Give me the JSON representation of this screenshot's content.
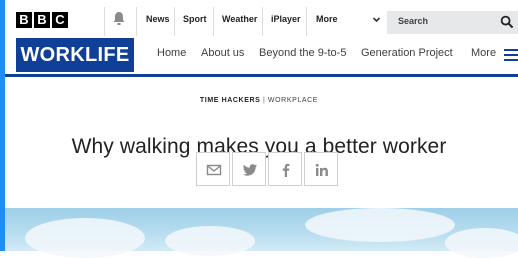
{
  "bbc_bar": {
    "logo_letters": [
      "B",
      "B",
      "C"
    ],
    "links": [
      "News",
      "Sport",
      "Weather",
      "iPlayer",
      "More"
    ],
    "search_placeholder": "Search"
  },
  "worklife_nav": {
    "logo": "WORKLIFE",
    "links": [
      "Home",
      "About us",
      "Beyond the 9-to-5",
      "Generation Project"
    ],
    "more": "More"
  },
  "article": {
    "kicker_primary": "TIME HACKERS",
    "kicker_separator": "|",
    "kicker_secondary": "WORKPLACE",
    "headline": "Why walking makes you a better worker"
  },
  "share_buttons": [
    "email-icon",
    "twitter-icon",
    "facebook-icon",
    "linkedin-icon"
  ],
  "colors": {
    "brand_blue": "#0f3f97",
    "accent_stripe": "#1d8ff2",
    "search_bg": "#e6e8ea"
  }
}
